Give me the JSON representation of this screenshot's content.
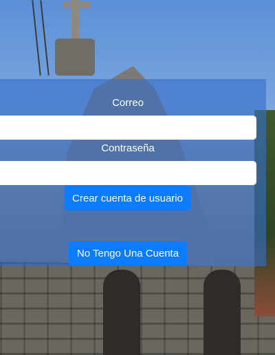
{
  "form": {
    "email_label": "Correo",
    "email_value": "",
    "password_label": "Contraseña",
    "password_value": "",
    "create_account_label": "Crear cuenta de usuario",
    "no_account_label": "No Tengo Una Cuenta"
  },
  "colors": {
    "panel": "#366ec8",
    "button": "#0b7cff"
  }
}
